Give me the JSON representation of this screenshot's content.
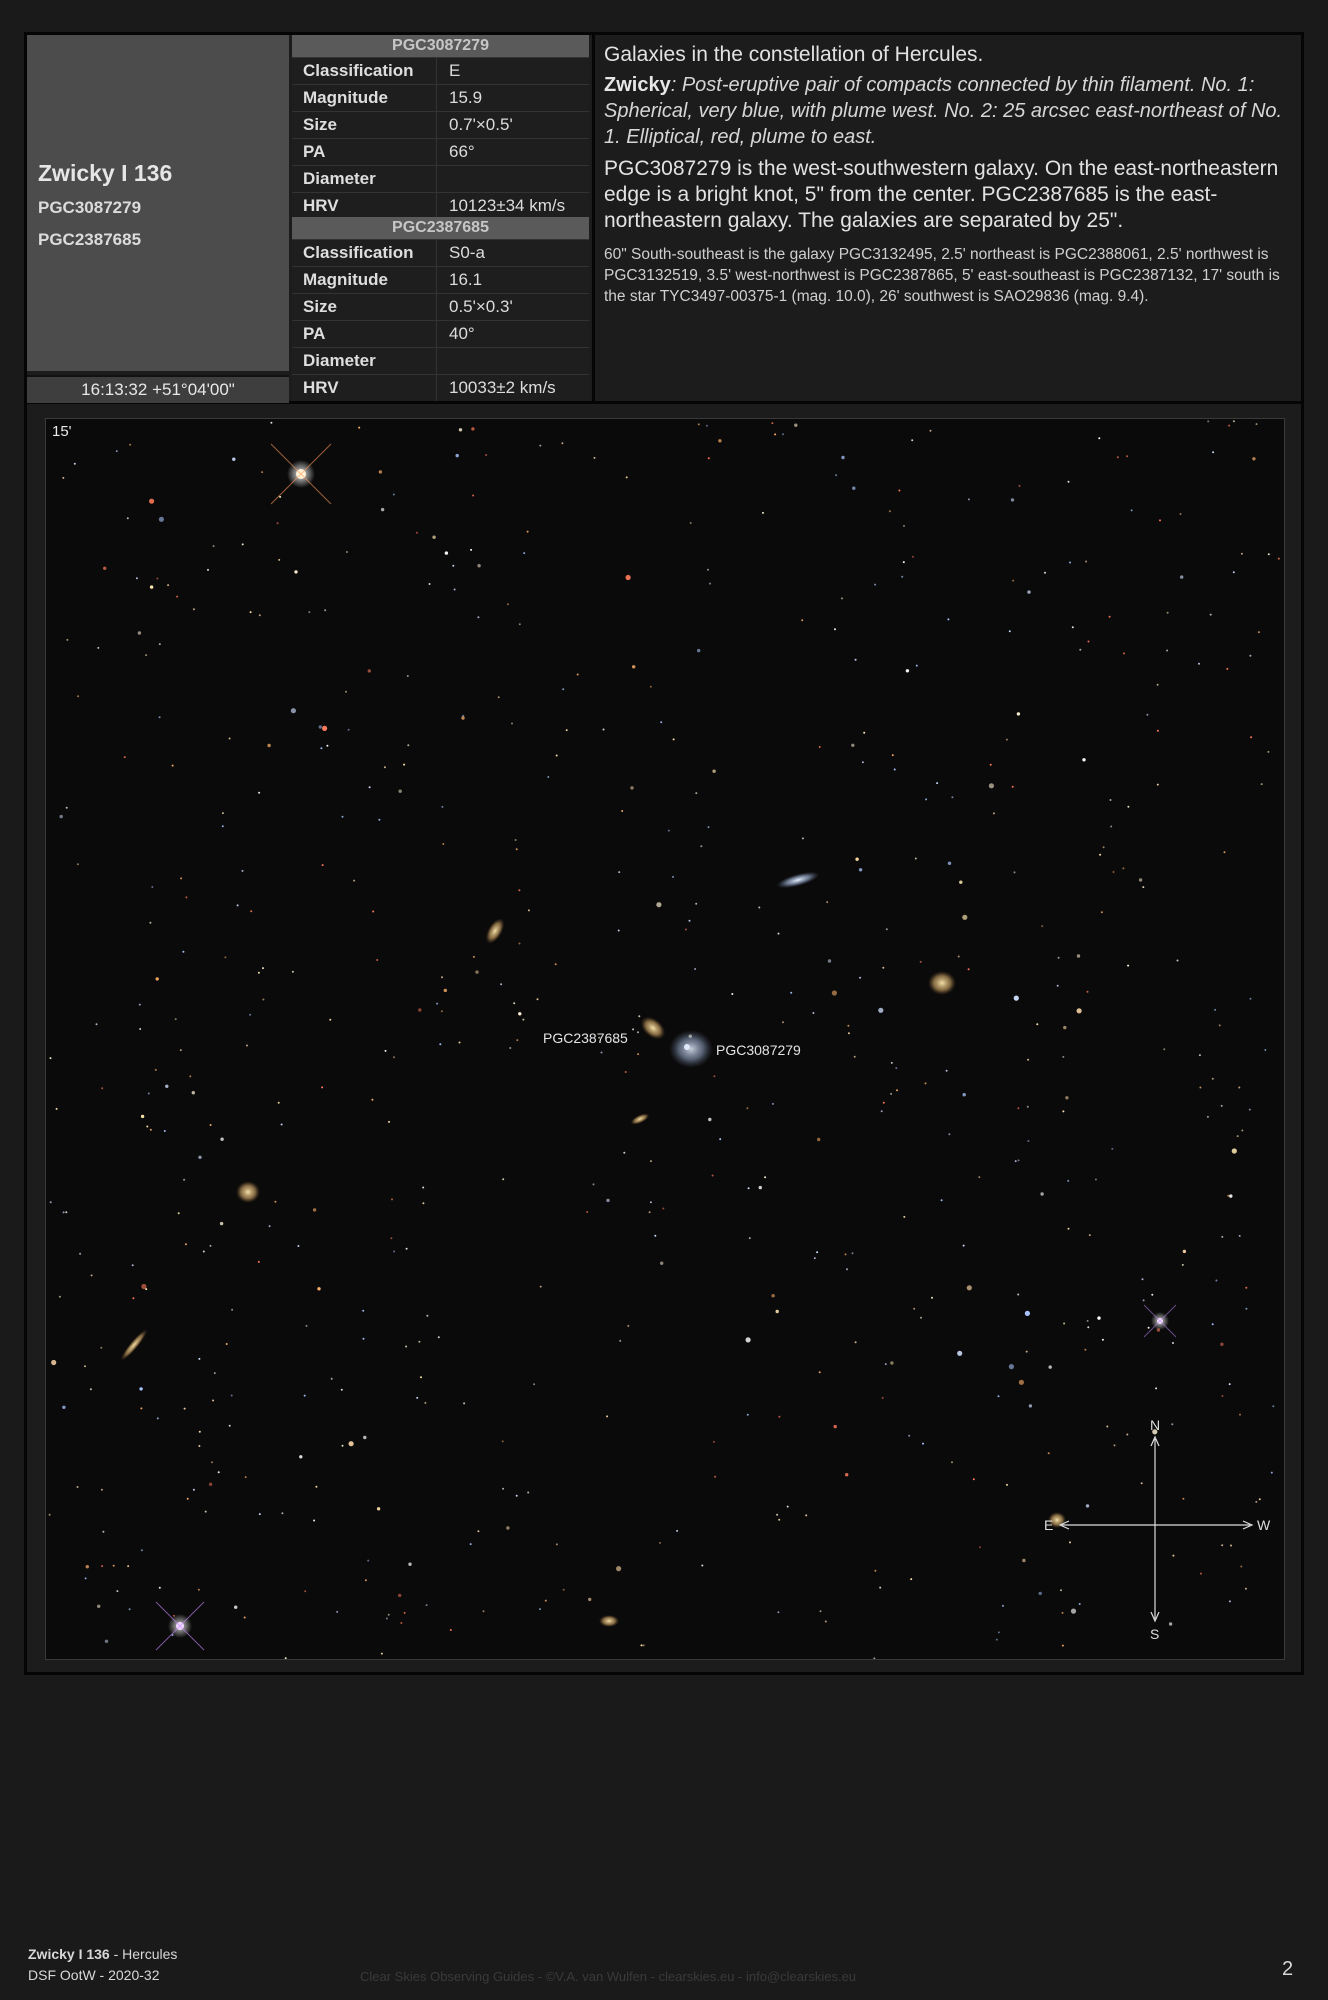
{
  "object": {
    "name": "Zwicky I 136",
    "alt_names": [
      "PGC3087279",
      "PGC2387685"
    ],
    "coordinates": "16:13:32 +51°04'00\""
  },
  "tables": [
    {
      "title": "PGC3087279",
      "rows": [
        {
          "key": "Classification",
          "value": "E"
        },
        {
          "key": "Magnitude",
          "value": "15.9"
        },
        {
          "key": "Size",
          "value": "0.7'×0.5'"
        },
        {
          "key": "PA",
          "value": "66°"
        },
        {
          "key": "Diameter",
          "value": ""
        },
        {
          "key": "HRV",
          "value": "10123±34 km/s"
        }
      ]
    },
    {
      "title": "PGC2387685",
      "rows": [
        {
          "key": "Classification",
          "value": "S0-a"
        },
        {
          "key": "Magnitude",
          "value": "16.1"
        },
        {
          "key": "Size",
          "value": "0.5'×0.3'"
        },
        {
          "key": "PA",
          "value": "40°"
        },
        {
          "key": "Diameter",
          "value": ""
        },
        {
          "key": "HRV",
          "value": "10033±2 km/s"
        }
      ]
    }
  ],
  "description": {
    "intro": "Galaxies in the constellation of Hercules.",
    "zwicky_label": "Zwicky",
    "zwicky_text": ": Post-eruptive pair of compacts connected by thin filament. No. 1: Spherical, very blue, with plume west. No. 2: 25 arcsec east-northeast of No. 1. Elliptical, red, plume to east.",
    "details": "PGC3087279 is the west-southwestern galaxy. On the east-northeastern edge is a bright knot, 5\" from the center. PGC2387685 is the east-northeastern galaxy. The galaxies are separated by 25\".",
    "surroundings": "60\" South-southeast is the galaxy PGC3132495, 2.5' northeast is PGC2388061, 2.5' northwest is PGC3132519, 3.5' west-northwest is PGC2387865, 5' east-southeast is PGC2387132, 17' south is the star TYC3497-00375-1 (mag. 10.0), 26' southwest is SAO29836 (mag. 9.4)."
  },
  "image": {
    "scale_label": "15'",
    "labels": {
      "left_galaxy": "PGC2387685",
      "right_galaxy": "PGC3087279"
    },
    "compass": {
      "n": "N",
      "s": "S",
      "e": "E",
      "w": "W"
    }
  },
  "footer": {
    "name": "Zwicky I 136",
    "constellation": " - Hercules",
    "issue": "DSF OotW - 2020-32",
    "credits": "Clear Skies Observing Guides - ©V.A. van Wulfen - clearskies.eu - info@clearskies.eu",
    "page": "2"
  }
}
